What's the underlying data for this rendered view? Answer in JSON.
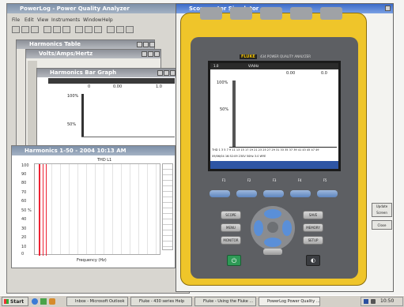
{
  "desktop": {
    "bg": "#f4f4f2"
  },
  "main_window": {
    "title": "PowerLog - Power Quality Analyzer",
    "menu": [
      "File",
      "Edit",
      "View",
      "Instruments",
      "Window",
      "Help"
    ]
  },
  "child_window_1": {
    "title": "Harmonics Table"
  },
  "child_window_2": {
    "title": "Volts/Amps/Hertz"
  },
  "child_window_3": {
    "title": "Harmonics Bar Graph"
  },
  "inner_graph": {
    "col1": "0",
    "col2": "0.00",
    "col3": "1.0",
    "label_top": "100%",
    "label_mid": "50%"
  },
  "bottom_chart": {
    "title": "Harmonics 1-50 - 2004 10:13 AM",
    "graph_title": "THD L1",
    "xlabel": "Frequency (Hz)",
    "ylabels": [
      "100",
      "90",
      "80",
      "70",
      "60",
      "50 %",
      "40",
      "30",
      "20",
      "10",
      "0"
    ]
  },
  "scope_window": {
    "title": "Scopemeter Simulator"
  },
  "device": {
    "brand": "FLUKE",
    "model": "434 POWER QUALITY ANALYZER",
    "screen_header": [
      "1.0",
      "V/A/Hz",
      "0.00",
      "0.0"
    ],
    "screen_labels": {
      "top": "100%",
      "mid": "50%",
      "bottom_row": "THD 1 3 5 7 9 11 13 15 17 19 21 23 25 27 29 31 33 35 37 39 41 43 45 47 49"
    },
    "status": "09/06/04 16:52:09 230V 50Hz 3.0 WYE",
    "fkeys": [
      "F1",
      "F2",
      "F3",
      "F4",
      "F5"
    ],
    "left_buttons": [
      "SCOPE",
      "MENU",
      "MONITOR"
    ],
    "right_buttons": [
      "SAVE",
      "MEMORY",
      "SETUP"
    ],
    "power_symbol": "⏻",
    "hold_symbol": "◐"
  },
  "side_panel": {
    "buttons": [
      "Update Screen",
      "Close"
    ]
  },
  "taskbar": {
    "start": "Start",
    "items": [
      "Inbox - Microsoft Outlook",
      "Fluke - 430 series Help",
      "Fluke - Using the Fluke ...",
      "PowerLog Power Quality ..."
    ],
    "time": "10:50"
  }
}
